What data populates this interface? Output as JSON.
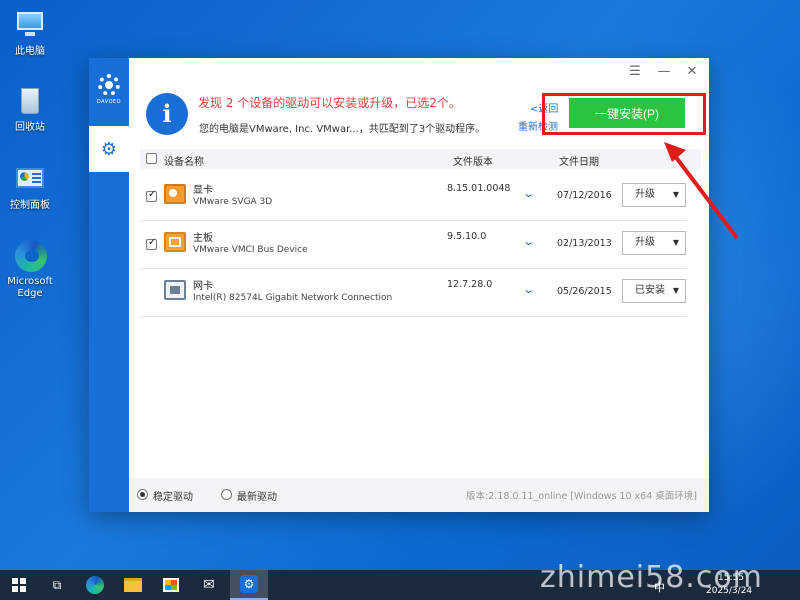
{
  "desktop": {
    "icons": [
      {
        "label": "此电脑"
      },
      {
        "label": "回收站"
      },
      {
        "label": "控制面板"
      },
      {
        "label": "Microsoft Edge"
      }
    ]
  },
  "app": {
    "brand": "DAVOED",
    "headline": "发现 2 个设备的驱动可以安装或升级，已选2个。",
    "subline": "您的电脑是VMware, Inc. VMwar...，共匹配到了3个驱动程序。",
    "back_link": "<返回",
    "rescan_link": "重新检测",
    "install_button": "一键安装(P)",
    "columns": {
      "device": "设备名称",
      "version": "文件版本",
      "date": "文件日期"
    },
    "rows": [
      {
        "type": "显卡",
        "name": "VMware SVGA 3D",
        "version": "8.15.01.0048",
        "date": "07/12/2016",
        "action": "升级",
        "checked": true
      },
      {
        "type": "主板",
        "name": "VMware VMCI Bus Device",
        "version": "9.5.10.0",
        "date": "02/13/2013",
        "action": "升级",
        "checked": true
      },
      {
        "type": "网卡",
        "name": "Intel(R) 82574L Gigabit Network Connection",
        "version": "12.7.28.0",
        "date": "05/26/2015",
        "action": "已安装",
        "checked": false
      }
    ],
    "footer": {
      "stable_label": "稳定驱动",
      "latest_label": "最新驱动",
      "selected": "stable",
      "version_info": "版本:2.18.0.11_online [Windows 10 x64 桌面环境]"
    }
  },
  "taskbar": {
    "time": "15:55",
    "date": "2025/3/24",
    "ime": "中"
  },
  "watermark": "zhimei58.com",
  "colors": {
    "accent": "#1a6fd6",
    "install_green": "#2cc33f",
    "headline_red": "#e0433f",
    "annotation_red": "#e21b1b"
  }
}
